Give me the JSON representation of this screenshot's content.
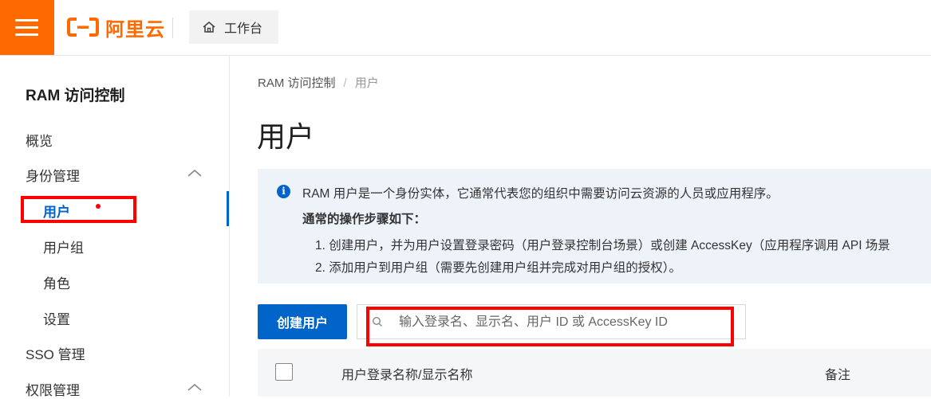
{
  "topbar": {
    "brand": "阿里云",
    "workbench_label": "工作台"
  },
  "sidebar": {
    "title": "RAM 访问控制",
    "items": [
      {
        "label": "概览"
      },
      {
        "label": "身份管理"
      },
      {
        "label": "用户"
      },
      {
        "label": "用户组"
      },
      {
        "label": "角色"
      },
      {
        "label": "设置"
      },
      {
        "label": "SSO 管理"
      },
      {
        "label": "权限管理"
      }
    ]
  },
  "breadcrumb": {
    "root": "RAM 访问控制",
    "separator": "/",
    "current": "用户"
  },
  "page": {
    "title": "用户"
  },
  "info": {
    "description": "RAM 用户是一个身份实体，它通常代表您的组织中需要访问云资源的人员或应用程序。",
    "steps_title": "通常的操作步骤如下：",
    "step1": "1. 创建用户，并为用户设置登录密码（用户登录控制台场景）或创建 AccessKey（应用程序调用 API 场景",
    "step2": "2. 添加用户到用户组（需要先创建用户组并完成对用户组的授权）。"
  },
  "toolbar": {
    "create_button": "创建用户",
    "search_placeholder": "输入登录名、显示名、用户 ID 或 AccessKey ID"
  },
  "table": {
    "columns": [
      "用户登录名称/显示名称",
      "备注"
    ]
  },
  "colors": {
    "brand_orange": "#ff6a00",
    "primary_blue": "#0064c8",
    "annotation_red": "#ff0000",
    "info_bg": "#eef3fa"
  }
}
